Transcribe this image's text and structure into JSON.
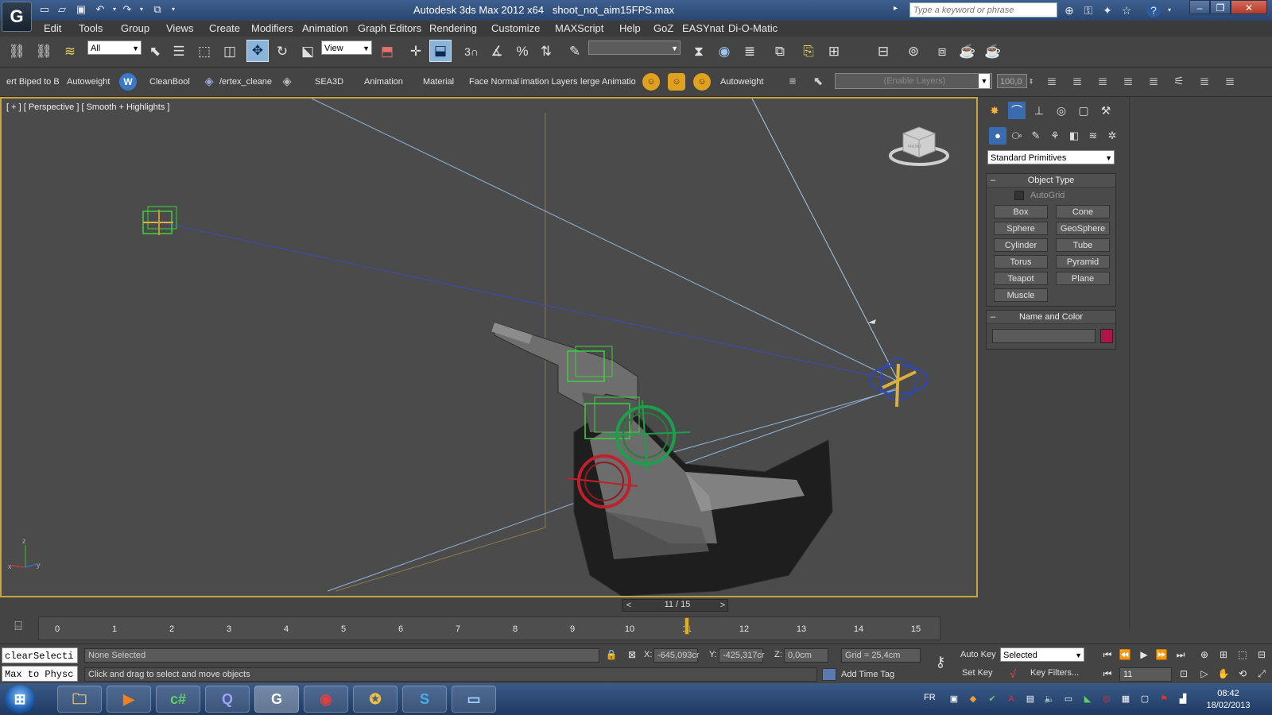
{
  "titlebar": {
    "app_icon_label": "G",
    "app_name": "Autodesk 3ds Max  2012 x64",
    "file_name": "shoot_not_aim15FPS.max",
    "search_placeholder": "Type a keyword or phrase"
  },
  "menu": [
    "Edit",
    "Tools",
    "Group",
    "Views",
    "Create",
    "Modifiers",
    "Animation",
    "Graph Editors",
    "Rendering",
    "Customize",
    "MAXScript",
    "Help",
    "GoZ",
    "EASYnat",
    "Di-O-Matic"
  ],
  "main_toolbar": {
    "selection_filter": "All",
    "reference_coord": "View",
    "snap_label": "3",
    "named_selection": ""
  },
  "custom_toolbar": {
    "items": [
      "ert Biped to B",
      "Autoweight",
      "CleanBool",
      "/ertex_cleane",
      "SEA3D",
      "Animation",
      "Material",
      "Face Normal",
      "imation Layers",
      "lerge Animatio",
      "Autoweight"
    ],
    "layer_dropdown": "(Enable Layers)",
    "layer_weight": "100,0"
  },
  "viewport": {
    "label": "[ + ] [ Perspective ] [ Smooth + Highlights ]",
    "viewcube_label": "FRONT",
    "axis_x": "x",
    "axis_y": "y",
    "axis_z": "z"
  },
  "command_panel": {
    "category": "Standard Primitives",
    "object_type_title": "Object Type",
    "autogrid_label": "AutoGrid",
    "buttons": [
      "Box",
      "Cone",
      "Sphere",
      "GeoSphere",
      "Cylinder",
      "Tube",
      "Torus",
      "Pyramid",
      "Teapot",
      "Plane",
      "Muscle"
    ],
    "name_color_title": "Name and Color",
    "name_value": "",
    "swatch_color": "#b0154a"
  },
  "timeline": {
    "frame_display": "11 / 15",
    "prev": "<",
    "next": ">",
    "ticks": [
      "0",
      "1",
      "2",
      "3",
      "4",
      "5",
      "6",
      "7",
      "8",
      "9",
      "10",
      "11",
      "12",
      "13",
      "14",
      "15"
    ],
    "current_frame": 11,
    "total_frames": 15
  },
  "status": {
    "listener_top": "clearSelecti",
    "listener_bottom": "Max to Physc",
    "selection_status": "None Selected",
    "prompt": "Click and drag to select and move objects",
    "x_label": "X:",
    "x_value": "-645,093cr",
    "y_label": "Y:",
    "y_value": "-425,317cr",
    "z_label": "Z:",
    "z_value": "0,0cm",
    "grid": "Grid = 25,4cm",
    "add_time_tag": "Add Time Tag",
    "auto_key": "Auto Key",
    "set_key": "Set Key",
    "key_mode": "Selected",
    "key_filters": "Key Filters...",
    "frame_field": "11"
  },
  "taskbar": {
    "language": "FR",
    "time": "08:42",
    "date": "18/02/2013",
    "apps": [
      "explorer",
      "media",
      "c#",
      "qbf",
      "3dsmax",
      "chrome",
      "counter-strike",
      "skype",
      "display"
    ]
  },
  "colors": {
    "accent_active": "#8ab4d8",
    "viewport_border": "#c8a23c",
    "taskbar": "#2a4a78"
  }
}
